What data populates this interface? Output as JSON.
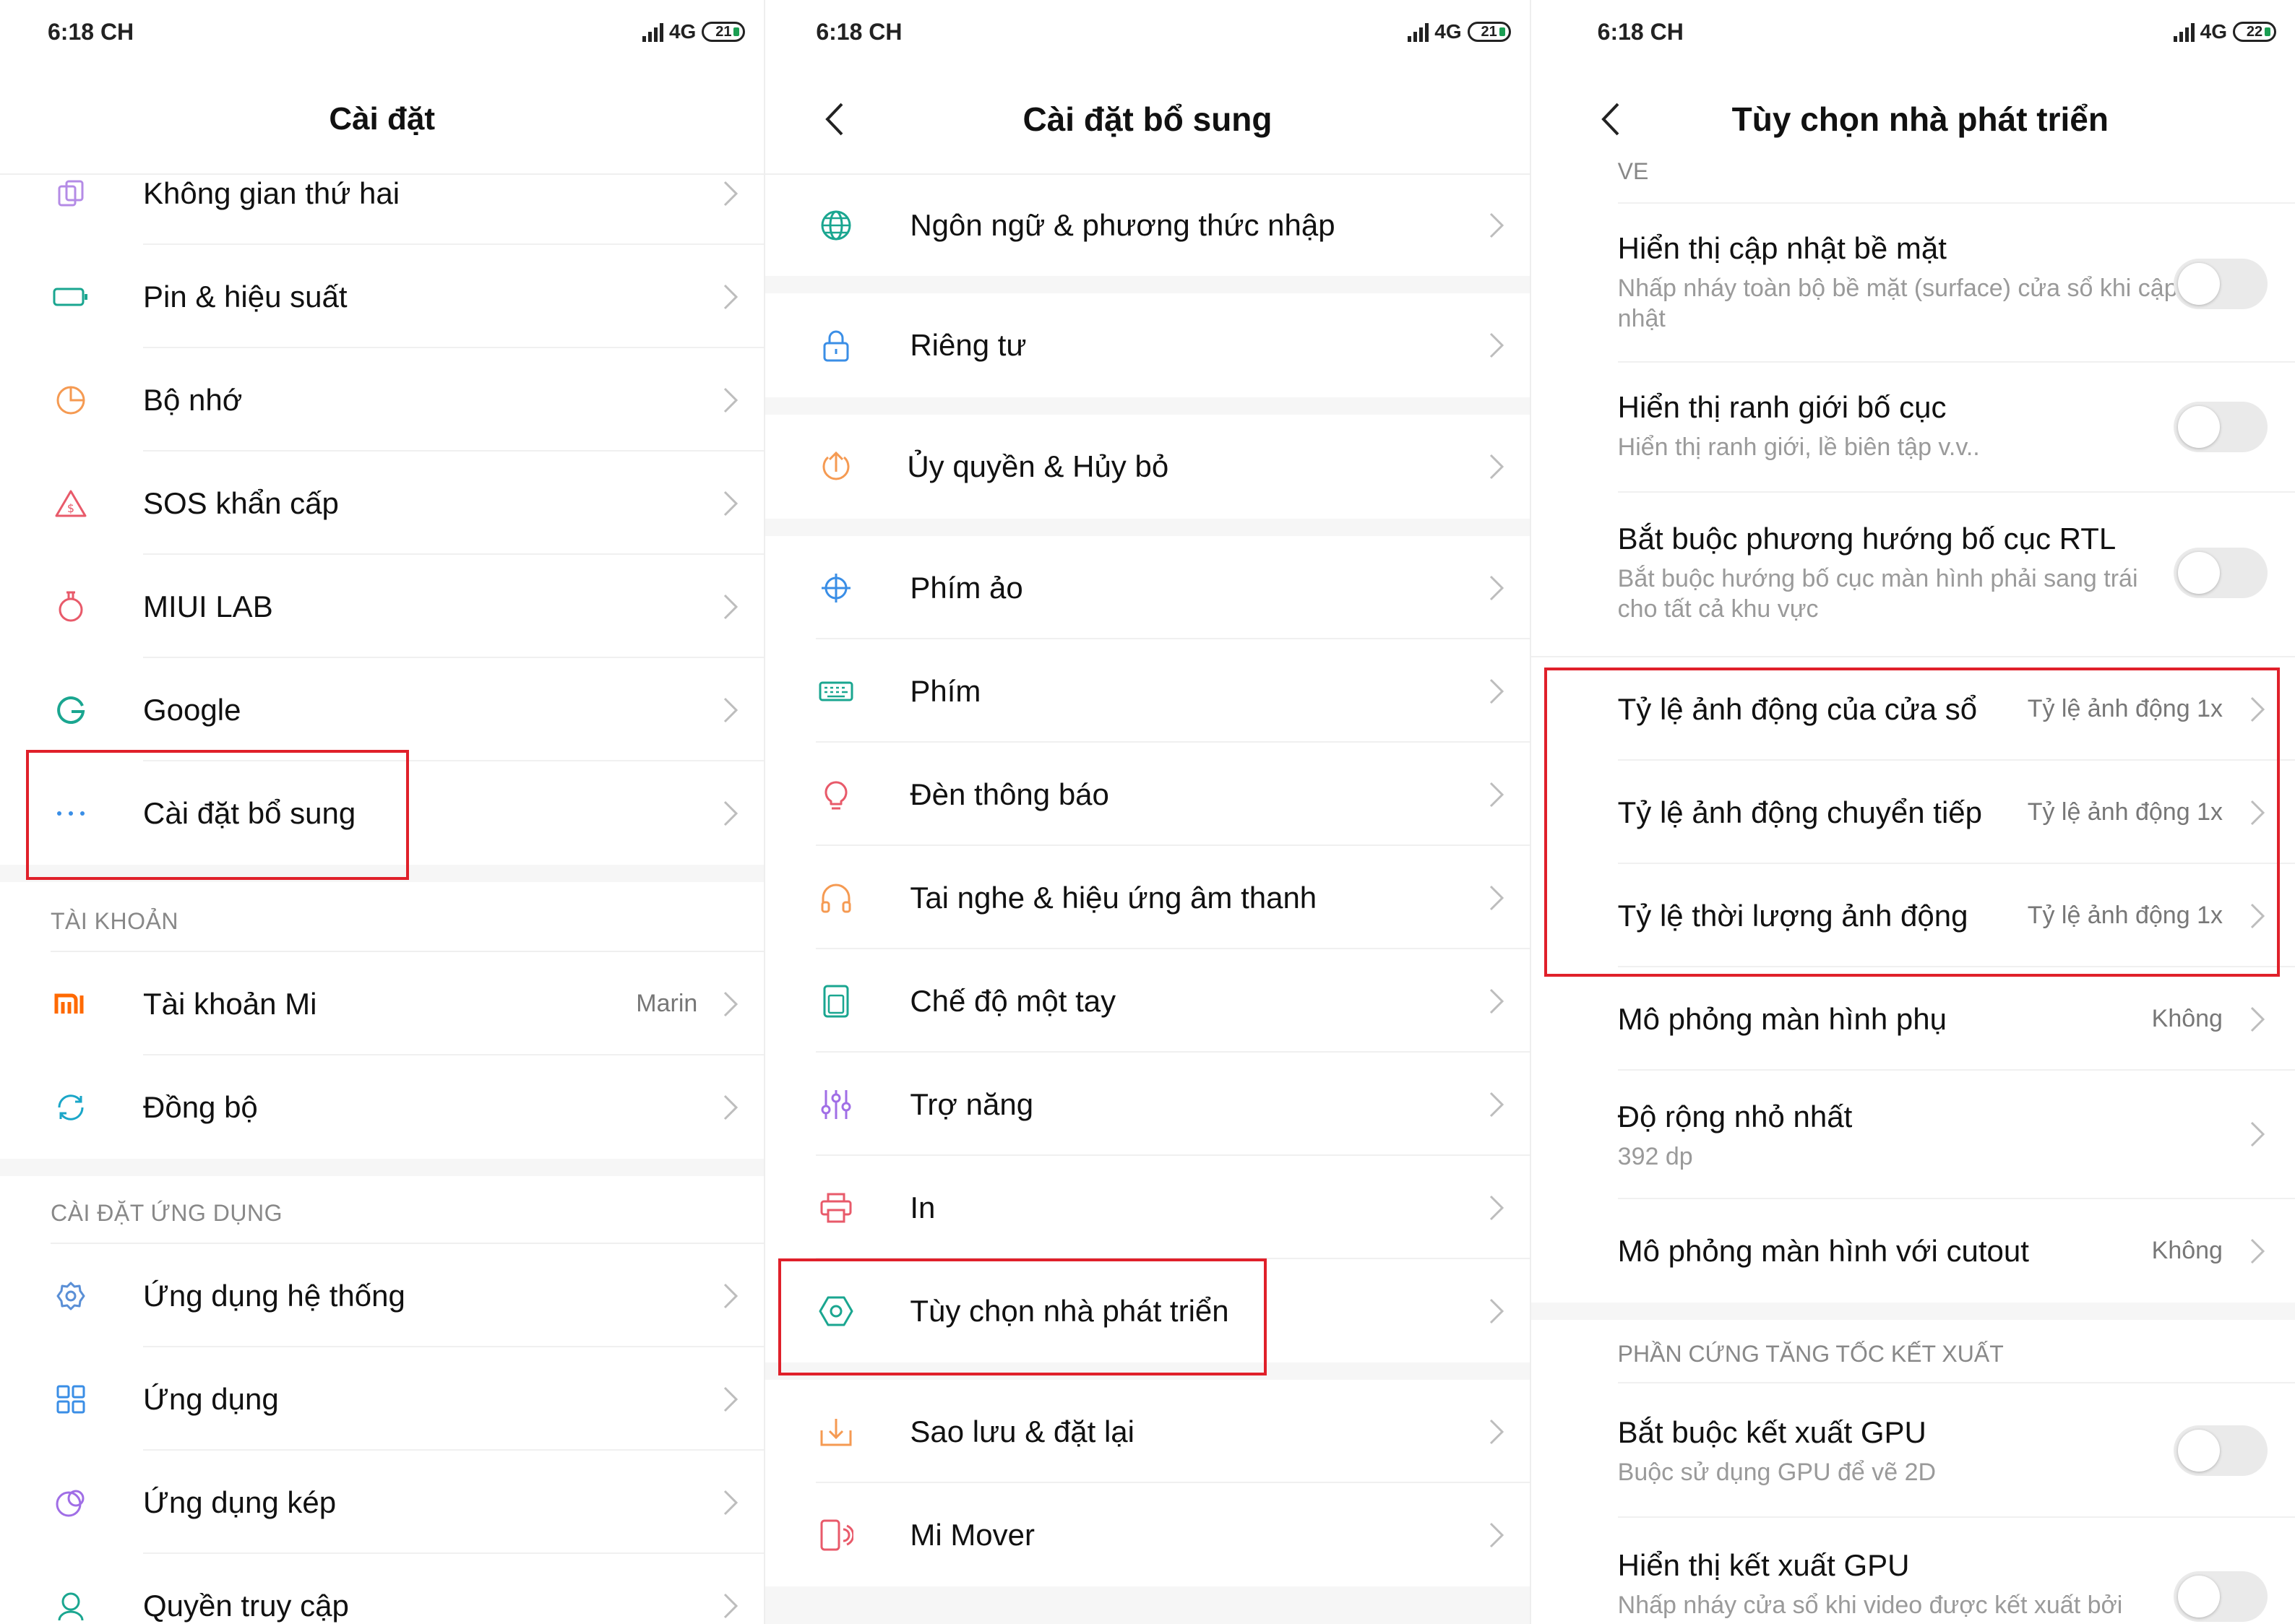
{
  "status_bar": {
    "screen1": {
      "time": "6:18 CH",
      "network": "4G",
      "battery": "21"
    },
    "screen2": {
      "time": "6:18 CH",
      "network": "4G",
      "battery": "21"
    },
    "screen3": {
      "time": "6:18 CH",
      "network": "4G",
      "battery": "22"
    }
  },
  "screen1": {
    "title": "Cài đặt",
    "items": [
      {
        "label": "Không gian thứ hai",
        "icon": "second-space-icon"
      },
      {
        "label": "Pin & hiệu suất",
        "icon": "battery-icon"
      },
      {
        "label": "Bộ nhớ",
        "icon": "storage-icon"
      },
      {
        "label": "SOS khẩn cấp",
        "icon": "sos-icon"
      },
      {
        "label": "MIUI LAB",
        "icon": "lab-flask-icon"
      },
      {
        "label": "Google",
        "icon": "google-icon"
      },
      {
        "label": "Cài đặt bổ sung",
        "icon": "more-dots-icon"
      }
    ],
    "section_accounts": "TÀI KHOẢN",
    "accounts": [
      {
        "label": "Tài khoản Mi",
        "value": "Marin",
        "icon": "mi-logo-icon"
      },
      {
        "label": "Đồng bộ",
        "icon": "sync-icon"
      }
    ],
    "section_apps": "CÀI ĐẶT ỨNG DỤNG",
    "apps": [
      {
        "label": "Ứng dụng hệ thống",
        "icon": "gear-icon"
      },
      {
        "label": "Ứng dụng",
        "icon": "apps-grid-icon"
      },
      {
        "label": "Ứng dụng kép",
        "icon": "dual-apps-icon"
      },
      {
        "label": "Quyền truy cập",
        "icon": "permissions-icon"
      }
    ]
  },
  "screen2": {
    "title": "Cài đặt bổ sung",
    "items": [
      {
        "label": "Ngôn ngữ & phương thức nhập",
        "icon": "globe-icon"
      },
      {
        "label": "Riêng tư",
        "icon": "lock-icon"
      },
      {
        "label": "Ủy quyền & Hủy bỏ",
        "icon": "upload-icon"
      },
      {
        "label": "Phím ảo",
        "icon": "crosshair-icon"
      },
      {
        "label": "Phím",
        "icon": "keyboard-icon"
      },
      {
        "label": "Đèn thông báo",
        "icon": "bulb-icon"
      },
      {
        "label": "Tai nghe & hiệu ứng âm thanh",
        "icon": "headphones-icon"
      },
      {
        "label": "Chế độ một tay",
        "icon": "one-hand-icon"
      },
      {
        "label": "Trợ năng",
        "icon": "sliders-icon"
      },
      {
        "label": "In",
        "icon": "printer-icon"
      },
      {
        "label": "Tùy chọn nhà phát triển",
        "icon": "developer-hexagon-icon"
      },
      {
        "label": "Sao lưu & đặt lại",
        "icon": "backup-icon"
      },
      {
        "label": "Mi Mover",
        "icon": "phone-transfer-icon"
      }
    ]
  },
  "screen3": {
    "title": "Tùy chọn nhà phát triển",
    "cut_section": "VẼ",
    "toggles_top": [
      {
        "title": "Hiển thị cập nhật bề mặt",
        "subtitle": "Nhấp nháy toàn bộ bề mặt (surface) cửa sổ khi cập nhật"
      },
      {
        "title": "Hiển thị ranh giới bố cục",
        "subtitle": "Hiển thị ranh giới, lề biên tập v.v.."
      },
      {
        "title": "Bắt buộc phương hướng bố cục RTL",
        "subtitle": "Bắt buộc hướng bố cục màn hình phải sang trái cho tất cả khu vực"
      }
    ],
    "animation_rows": [
      {
        "title": "Tỷ lệ ảnh động của cửa sổ",
        "value": "Tỷ lệ ảnh động 1x"
      },
      {
        "title": "Tỷ lệ ảnh động chuyển tiếp",
        "value": "Tỷ lệ ảnh động 1x"
      },
      {
        "title": "Tỷ lệ thời lượng ảnh động",
        "value": "Tỷ lệ ảnh động 1x"
      }
    ],
    "secondary_display": {
      "title": "Mô phỏng màn hình phụ",
      "value": "Không"
    },
    "smallest_width": {
      "title": "Độ rộng nhỏ nhất",
      "subtitle": "392 dp"
    },
    "cutout": {
      "title": "Mô phỏng màn hình với cutout",
      "value": "Không"
    },
    "section_gpu": "PHẦN CỨNG TĂNG TỐC KẾT XUẤT",
    "gpu_rows": [
      {
        "title": "Bắt buộc kết xuất GPU",
        "subtitle": "Buộc sử dụng GPU để vẽ 2D"
      },
      {
        "title": "Hiển thị kết xuất GPU",
        "subtitle": "Nhấp nháy cửa sổ khi video được kết xuất bởi"
      }
    ]
  },
  "colors": {
    "highlight": "#e0202a",
    "mi_orange": "#ff6900",
    "teal": "#1aa690",
    "toggle_off": "#eaeaea"
  }
}
